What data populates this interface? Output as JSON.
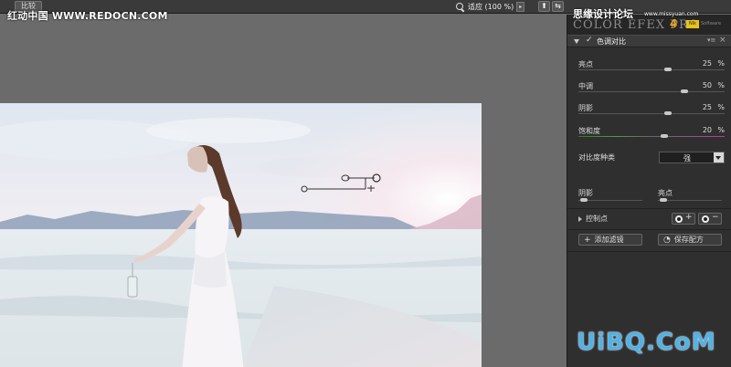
{
  "topbar": {
    "compare_label": "比较",
    "zoom_label": "适应 (100 %)",
    "zoom_arrow": "▸",
    "btn1_glyph": "⬆",
    "btn2_glyph": "⇆"
  },
  "watermarks": {
    "top_left": "红动中国 WWW.REDOCN.COM",
    "top_right": "思缘设计论坛",
    "top_right_url": "www.missyuan.com",
    "bottom_right": "UiBQ.CoM"
  },
  "panel": {
    "brand": "COLOR EFEX PRO",
    "brand_version": "4",
    "brand_badge": "Nik",
    "brand_small": "Software",
    "filter": {
      "title": "色调对比",
      "enabled": true,
      "check_glyph": "✓",
      "menu_glyph": "▾≡",
      "close_glyph": "×"
    },
    "sliders": [
      {
        "label": "亮点",
        "value": "25",
        "unit": "%",
        "level": 0.62
      },
      {
        "label": "中调",
        "value": "50",
        "unit": "%",
        "level": 0.74
      },
      {
        "label": "阴影",
        "value": "25",
        "unit": "%",
        "level": 0.62
      },
      {
        "label": "饱和度",
        "value": "20",
        "unit": "%",
        "level": 0.59
      }
    ],
    "contrast": {
      "label": "对比度种类",
      "value": "强"
    },
    "mini_sliders": [
      {
        "label": "阴影",
        "level": 0.0
      },
      {
        "label": "亮点",
        "level": 0.0
      }
    ],
    "control_points": {
      "label": "控制点",
      "add_glyph": "+",
      "remove_glyph": "−"
    },
    "buttons": {
      "add_filter": "添加滤镜",
      "add_filter_icon": "+",
      "save_recipe": "保存配方",
      "save_recipe_icon": "◔"
    }
  },
  "colors": {
    "panel_bg": "#2f2f2f",
    "canvas_bg": "#6b6b6b",
    "brand_accent": "#e8a418",
    "watermark_blue": "#4fb3e8"
  }
}
